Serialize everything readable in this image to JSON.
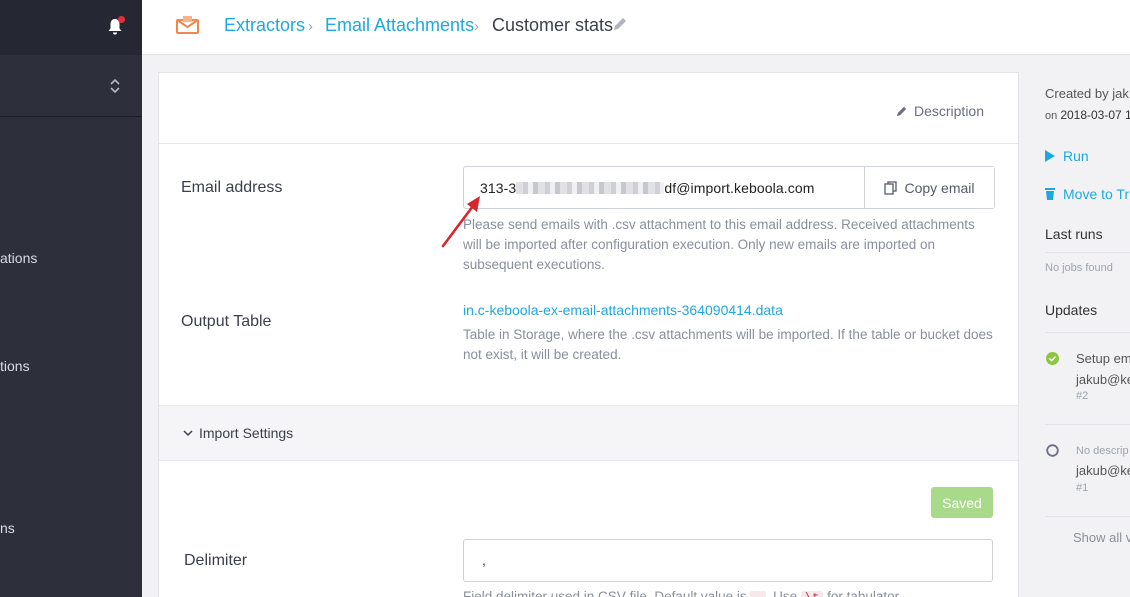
{
  "sidebar": {
    "items": [
      {
        "label": "ations"
      },
      {
        "label": "tions"
      },
      {
        "label": "ns"
      }
    ]
  },
  "breadcrumb": {
    "items": [
      "Extractors",
      "Email Attachments"
    ],
    "current": "Customer stats"
  },
  "panel": {
    "description_label": "Description",
    "email": {
      "label": "Email address",
      "value_prefix": "313-3",
      "value_suffix": "df@import.keboola.com",
      "copy_label": "Copy email",
      "help": "Please send emails with .csv attachment to this email address. Received attachments will be imported after configuration execution. Only new emails are imported on subsequent executions."
    },
    "output": {
      "label": "Output Table",
      "table_link": "in.c-keboola-ex-email-attachments-364090414.data",
      "help": "Table in Storage, where the .csv attachments will be imported. If the table or bucket does not exist, it will be created."
    },
    "import_settings": {
      "title": "Import Settings",
      "saved_label": "Saved",
      "delimiter_label": "Delimiter",
      "delimiter_value": ",",
      "delimiter_help_a": "Field delimiter used in CSV file. Default value is",
      "delimiter_help_code1": ",",
      "delimiter_help_b": ". Use",
      "delimiter_help_code2": "\\t",
      "delimiter_help_c": "for tabulator."
    }
  },
  "right": {
    "created_by": "Created by jak",
    "created_on_prefix": "on",
    "created_on": "2018-03-07 1",
    "run_label": "Run",
    "move_label": "Move to Tr",
    "last_runs": "Last runs",
    "no_jobs": "No jobs found",
    "updates": "Updates",
    "update1_title": "Setup em",
    "update1_user": "jakub@ke",
    "update1_num": "#2",
    "update2_title": "No descrip",
    "update2_user": "jakub@ke",
    "update2_num": "#1",
    "show_all": "Show all v"
  },
  "colors": {
    "accent": "#1fa8e0",
    "sidebar": "#2d2f3b",
    "success": "#8cc63f",
    "annotation_arrow": "#d9262c"
  }
}
